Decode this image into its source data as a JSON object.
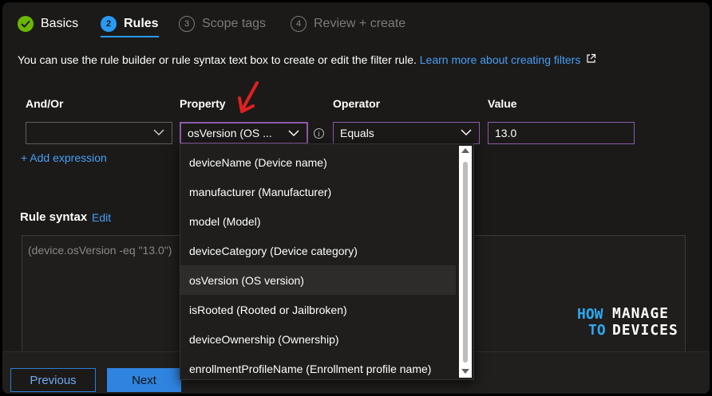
{
  "steps": [
    {
      "label": "Basics",
      "number": "",
      "state": "done"
    },
    {
      "label": "Rules",
      "number": "2",
      "state": "active"
    },
    {
      "label": "Scope tags",
      "number": "3",
      "state": "pending"
    },
    {
      "label": "Review + create",
      "number": "4",
      "state": "pending"
    }
  ],
  "description": {
    "text": "You can use the rule builder or rule syntax text box to create or edit the filter rule. ",
    "link": "Learn more about creating filters"
  },
  "columns": {
    "andor": "And/Or",
    "property": "Property",
    "operator": "Operator",
    "value": "Value"
  },
  "row": {
    "andor_value": "",
    "property_value": "osVersion (OS ...",
    "operator_value": "Equals",
    "value_value": "13.0"
  },
  "add_expression": "+ Add expression",
  "rule_syntax": {
    "title": "Rule syntax",
    "edit": "Edit",
    "text": "(device.osVersion -eq \"13.0\")"
  },
  "dropdown": {
    "items": [
      "deviceName (Device name)",
      "manufacturer (Manufacturer)",
      "model (Model)",
      "deviceCategory (Device category)",
      "osVersion (OS version)",
      "isRooted (Rooted or Jailbroken)",
      "deviceOwnership (Ownership)",
      "enrollmentProfileName (Enrollment profile name)"
    ],
    "selected_index": 4
  },
  "footer": {
    "previous": "Previous",
    "next": "Next"
  },
  "logo": {
    "how": "HOW",
    "to": "TO",
    "manage": "MANAGE",
    "devices": "DEVICES"
  },
  "colors": {
    "accent": "#2899f5",
    "success": "#6bb700",
    "focus_border": "#8e5aa8",
    "annotation_arrow": "#e02020"
  }
}
